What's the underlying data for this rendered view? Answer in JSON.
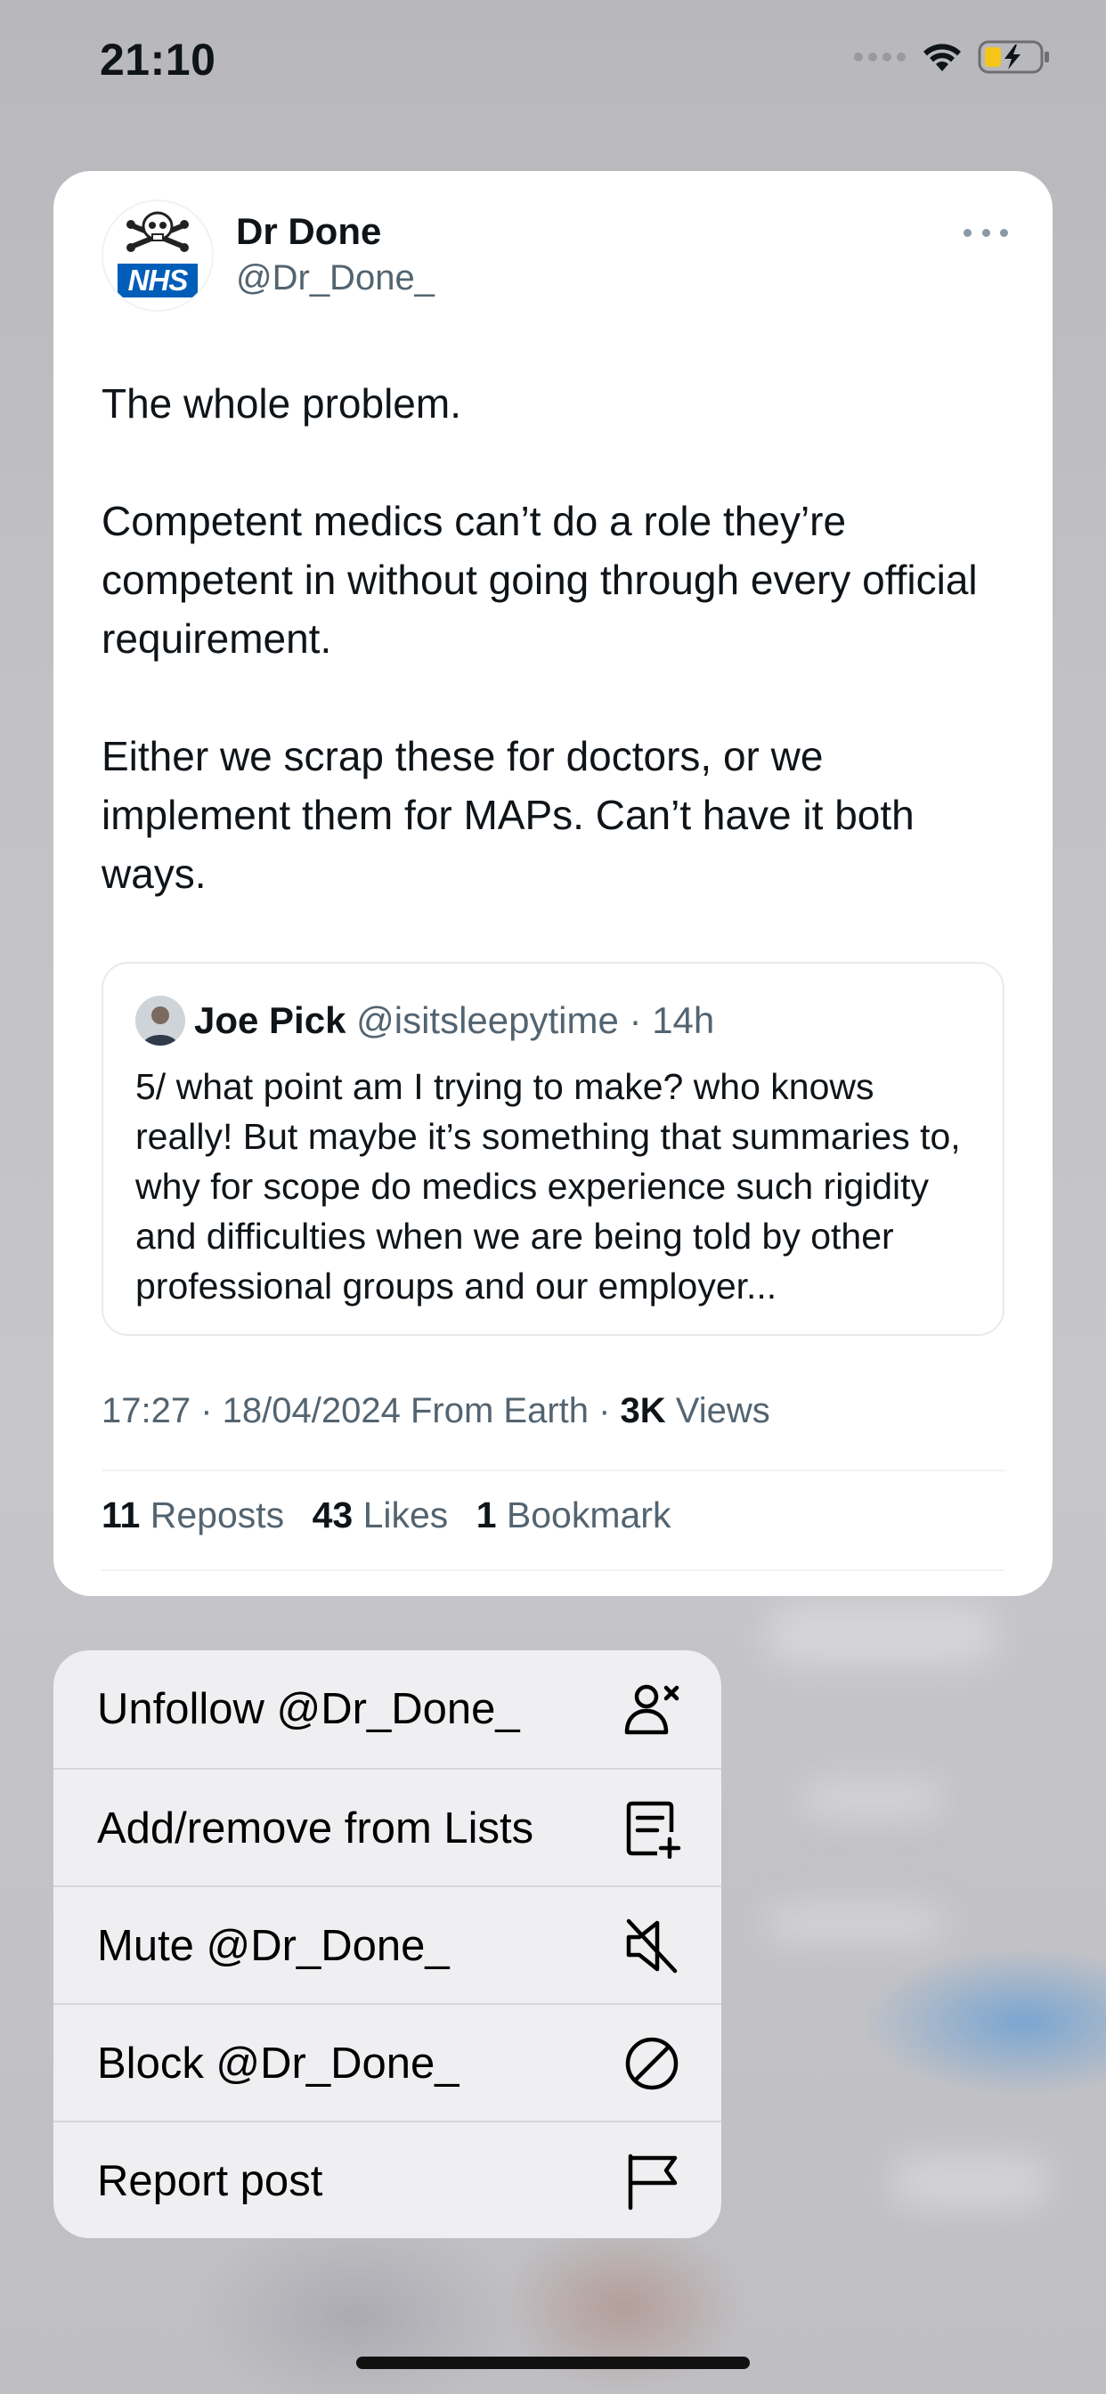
{
  "status_bar": {
    "time": "21:10"
  },
  "tweet": {
    "author_name": "Dr Done",
    "author_handle": "@Dr_Done_",
    "avatar_badge": "NHS",
    "paragraphs": [
      "The whole problem.",
      "Competent medics can’t do a role they’re competent in without going through every official requirement.",
      "Either we scrap these for doctors, or we implement them for MAPs. Can’t have it both ways."
    ],
    "quote": {
      "name": "Joe Pick",
      "handle": "@isitsleepytime",
      "separator": "·",
      "time": "14h",
      "text": "5/ what point am I trying to make? who knows really! But maybe it’s something that summaries to, why for scope do medics experience such rigidity and difficulties when we are being told by other professional groups and our employer..."
    },
    "meta": {
      "time_date": "17:27 · 18/04/2024 From Earth · ",
      "views_count": "3K",
      "views_label": " Views"
    },
    "stats": {
      "reposts_count": "11",
      "reposts_label": " Reposts",
      "likes_count": "43",
      "likes_label": " Likes",
      "bookmarks_count": "1",
      "bookmarks_label": " Bookmark"
    }
  },
  "menu": {
    "items": [
      {
        "label": "Unfollow @Dr_Done_",
        "icon": "unfollow-icon"
      },
      {
        "label": "Add/remove from Lists",
        "icon": "list-add-icon"
      },
      {
        "label": "Mute @Dr_Done_",
        "icon": "mute-icon"
      },
      {
        "label": "Block @Dr_Done_",
        "icon": "block-icon"
      },
      {
        "label": "Report post",
        "icon": "flag-icon"
      }
    ]
  },
  "colors": {
    "text_primary": "#0f1419",
    "text_secondary": "#536471",
    "menu_background": "#efeff1",
    "battery_charging": "#f5c518"
  }
}
